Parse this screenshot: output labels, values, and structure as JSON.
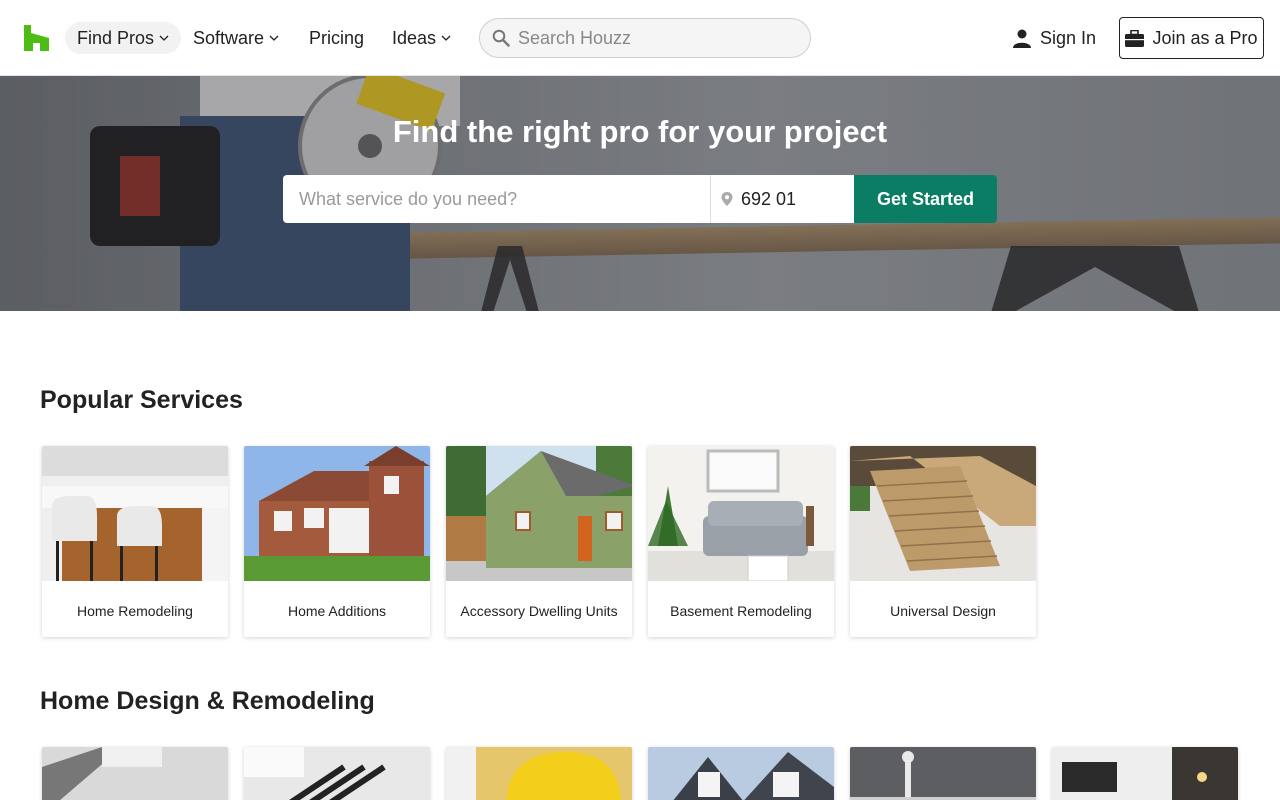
{
  "header": {
    "nav": [
      {
        "label": "Find Pros",
        "has_menu": true,
        "active": true
      },
      {
        "label": "Software",
        "has_menu": true,
        "active": false
      },
      {
        "label": "Pricing",
        "has_menu": false,
        "active": false
      },
      {
        "label": "Ideas",
        "has_menu": true,
        "active": false
      }
    ],
    "search_placeholder": "Search Houzz",
    "sign_in": "Sign In",
    "join_pro": "Join as a Pro"
  },
  "hero": {
    "title": "Find the right pro for your project",
    "service_placeholder": "What service do you need?",
    "zip_value": "692 01",
    "cta": "Get Started"
  },
  "popular": {
    "title": "Popular Services",
    "items": [
      {
        "label": "Home Remodeling"
      },
      {
        "label": "Home Additions"
      },
      {
        "label": "Accessory Dwelling Units"
      },
      {
        "label": "Basement Remodeling"
      },
      {
        "label": "Universal Design"
      }
    ]
  },
  "remodel": {
    "title": "Home Design & Remodeling"
  },
  "colors": {
    "brand": "#4dbc15",
    "cta": "#0a7d64"
  }
}
